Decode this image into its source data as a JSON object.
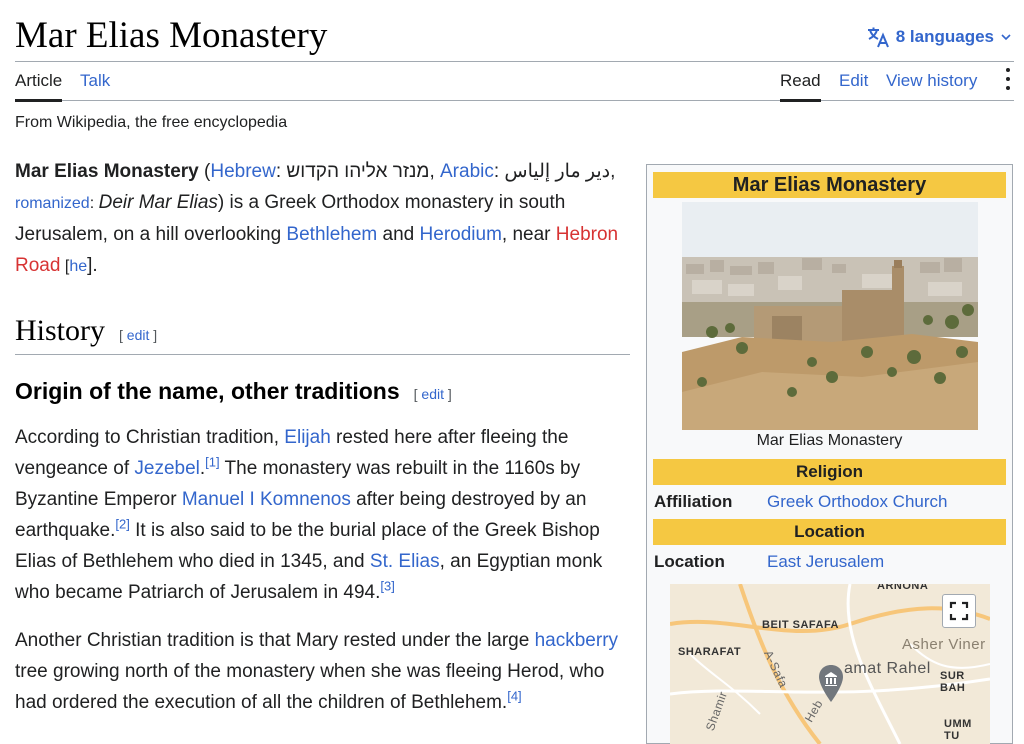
{
  "page": {
    "title": "Mar Elias Monastery",
    "languages_label": "8 languages",
    "tagline": "From Wikipedia, the free encyclopedia"
  },
  "tabs": {
    "article": "Article",
    "talk": "Talk",
    "read": "Read",
    "edit": "Edit",
    "history": "View history"
  },
  "intro": {
    "bold_title": "Mar Elias Monastery",
    "open_paren": " (",
    "hebrew_link": "Hebrew",
    "colon1": ": ",
    "hebrew_text": "מנזר אליהו הקדוש",
    "comma1": ", ",
    "arabic_link": "Arabic",
    "colon2": ": ",
    "arabic_text": "دير مار إلياس",
    "comma2": ",",
    "romanized_link": "romanized",
    "colon3": ": ",
    "romanized_text": "Deir Mar Elias",
    "text_a": ") is a Greek Orthodox monastery in south Jerusalem, on a hill overlooking ",
    "bethlehem_link": "Bethlehem",
    "text_b": " and ",
    "herodium_link": "Herodium",
    "text_c": ", near ",
    "hebron_link": "Hebron Road",
    "he_link": "he",
    "bracket_open": " [",
    "bracket_close": "]."
  },
  "history": {
    "heading": "History",
    "edit_open": "[ ",
    "edit_label": "edit",
    "edit_close": " ]"
  },
  "origin": {
    "heading": "Origin of the name, other traditions",
    "edit_open": "[ ",
    "edit_label": "edit",
    "edit_close": " ]"
  },
  "para1": {
    "t1": "According to Christian tradition, ",
    "elijah": "Elijah",
    "t2": " rested here after fleeing the vengeance of ",
    "jezebel": "Jezebel",
    "t2b": ".",
    "ref1": "[1]",
    "t3": " The monastery was rebuilt in the 1160s by Byzantine Emperor ",
    "manuel": "Manuel I Komnenos",
    "t4": " after being destroyed by an earthquake.",
    "ref2": "[2]",
    "t5": " It is also said to be the burial place of the Greek Bishop Elias of Bethlehem who died in 1345, and ",
    "elias": "St. Elias",
    "t6": ", an Egyptian monk who became Patriarch of Jerusalem in 494.",
    "ref3": "[3]"
  },
  "para2": {
    "t1": "Another Christian tradition is that Mary rested under the large ",
    "hackberry": "hackberry",
    "t2": " tree growing north of the monastery when she was fleeing Herod, who had ordered the execution of all the children of Bethlehem.",
    "ref4": "[4]"
  },
  "infobox": {
    "title": "Mar Elias Monastery",
    "caption": "Mar Elias Monastery",
    "religion_header": "Religion",
    "affiliation_label": "Affiliation",
    "affiliation_value": "Greek Orthodox Church",
    "location_header": "Location",
    "location_label": "Location",
    "location_value": "East Jerusalem",
    "map_labels": {
      "arnona": "ARNONA",
      "beit_safafa": "BEIT SAFAFA",
      "sharafat": "SHARAFAT",
      "asher_viner": "Asher Viner",
      "ramat_rahel": "amat Rahel",
      "sur_bah": "SUR BAH",
      "a_safa": "A-Safa",
      "shamir": "Shamir",
      "heb": "Heb",
      "umm_tu": "UMM TU"
    }
  },
  "colors": {
    "accent": "#3366cc",
    "redlink": "#d73333",
    "infobox_header": "#f5c842"
  }
}
